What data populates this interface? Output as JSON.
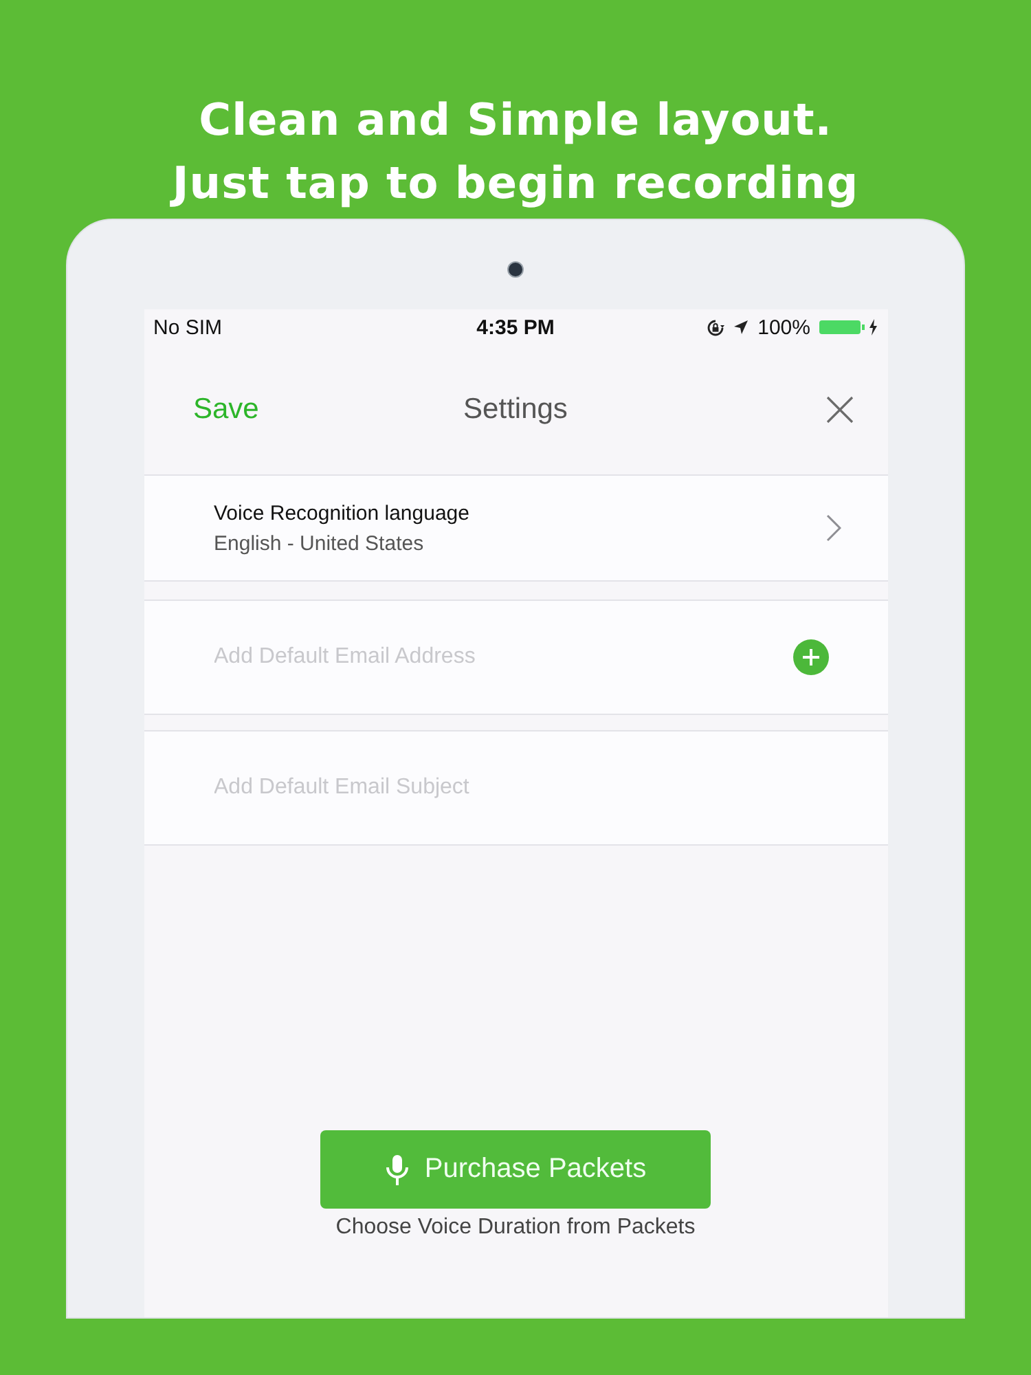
{
  "headline": [
    "Clean and Simple layout.",
    "Just tap to begin recording"
  ],
  "status_bar": {
    "carrier": "No SIM",
    "time": "4:35 PM",
    "battery": "100%"
  },
  "nav": {
    "left_action": "Save",
    "title": "Settings"
  },
  "settings": [
    {
      "kind": "link",
      "title": "Voice Recognition language",
      "value": "English - United States"
    },
    {
      "kind": "add_field",
      "placeholder": "Add Default Email Address"
    },
    {
      "kind": "field",
      "placeholder": "Add Default Email Subject"
    }
  ],
  "purchase": {
    "button": "Purchase Packets",
    "caption": "Choose Voice Duration from Packets"
  }
}
